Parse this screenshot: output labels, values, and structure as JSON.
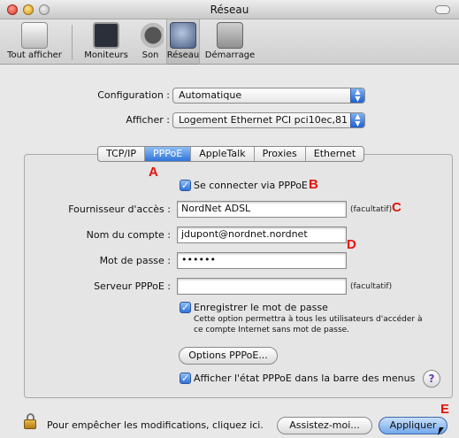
{
  "window": {
    "title": "Réseau"
  },
  "toolbar": {
    "items": [
      {
        "label": "Tout afficher",
        "icon": "show-all-icon"
      },
      {
        "label": "Moniteurs",
        "icon": "monitor-icon"
      },
      {
        "label": "Son",
        "icon": "speaker-icon"
      },
      {
        "label": "Réseau",
        "icon": "network-globe-icon",
        "selected": true
      },
      {
        "label": "Démarrage",
        "icon": "startup-disk-icon"
      }
    ]
  },
  "config": {
    "configuration_label": "Configuration :",
    "configuration_value": "Automatique",
    "afficher_label": "Afficher :",
    "afficher_value": "Logement Ethernet PCI pci10ec,81"
  },
  "tabs": [
    "TCP/IP",
    "PPPoE",
    "AppleTalk",
    "Proxies",
    "Ethernet"
  ],
  "active_tab": "PPPoE",
  "pppoe": {
    "connect_label": "Se connecter via PPPoE",
    "connect_checked": true,
    "provider_label": "Fournisseur d'accès :",
    "provider_value": "NordNet ADSL",
    "account_label": "Nom du compte :",
    "account_value": "jdupont@nordnet.nordnet",
    "password_label": "Mot de passe :",
    "password_value": "••••••",
    "server_label": "Serveur PPPoE :",
    "server_value": "",
    "optional": "(facultatif)",
    "save_password_label": "Enregistrer le mot de passe",
    "save_password_checked": true,
    "save_password_note_1": "Cette option permettra à tous les utilisateurs d'accéder à",
    "save_password_note_2": "ce compte Internet sans mot de passe.",
    "options_button": "Options PPPoE...",
    "show_status_label": "Afficher l'état PPPoE dans la barre des menus",
    "show_status_checked": true,
    "help": "?"
  },
  "footer": {
    "lock_text": "Pour empêcher les modifications, cliquez ici.",
    "assist_button": "Assistez-moi...",
    "apply_button": "Appliquer"
  },
  "annotations": {
    "a": "A",
    "b": "B",
    "c": "C",
    "d": "D",
    "e": "E"
  },
  "colors": {
    "accent_blue": "#2f74dc",
    "annotation_red": "#e3130b"
  }
}
